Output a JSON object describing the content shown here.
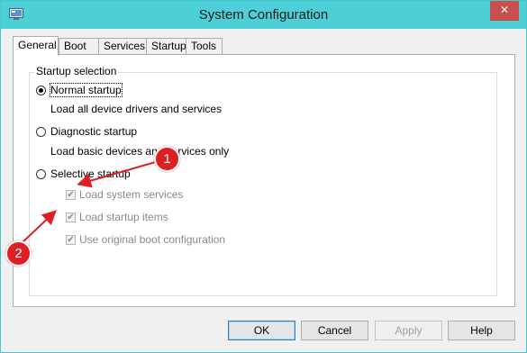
{
  "window": {
    "title": "System Configuration",
    "close_glyph": "✕",
    "titlebar_color": "#4ccfd6",
    "close_color": "#c7504c"
  },
  "tabs": [
    {
      "label": "General",
      "active": true
    },
    {
      "label": "Boot",
      "active": false
    },
    {
      "label": "Services",
      "active": false
    },
    {
      "label": "Startup",
      "active": false
    },
    {
      "label": "Tools",
      "active": false
    }
  ],
  "startup_selection": {
    "legend": "Startup selection",
    "normal": {
      "label": "Normal startup",
      "description": "Load all device drivers and services",
      "checked": true
    },
    "diagnostic": {
      "label": "Diagnostic startup",
      "description": "Load basic devices and services only",
      "checked": false
    },
    "selective": {
      "label": "Selective startup",
      "checked": false
    },
    "options": [
      {
        "label": "Load system services",
        "checked": true,
        "enabled": false
      },
      {
        "label": "Load startup items",
        "checked": true,
        "enabled": false
      },
      {
        "label": "Use original boot configuration",
        "checked": true,
        "enabled": false
      }
    ]
  },
  "buttons": {
    "ok": "OK",
    "cancel": "Cancel",
    "apply": "Apply",
    "help": "Help"
  },
  "annotations": [
    {
      "number": "1",
      "color": "#e01f25"
    },
    {
      "number": "2",
      "color": "#e01f25"
    }
  ],
  "icons": {
    "app": "system-config-app-icon",
    "check": "✔"
  }
}
